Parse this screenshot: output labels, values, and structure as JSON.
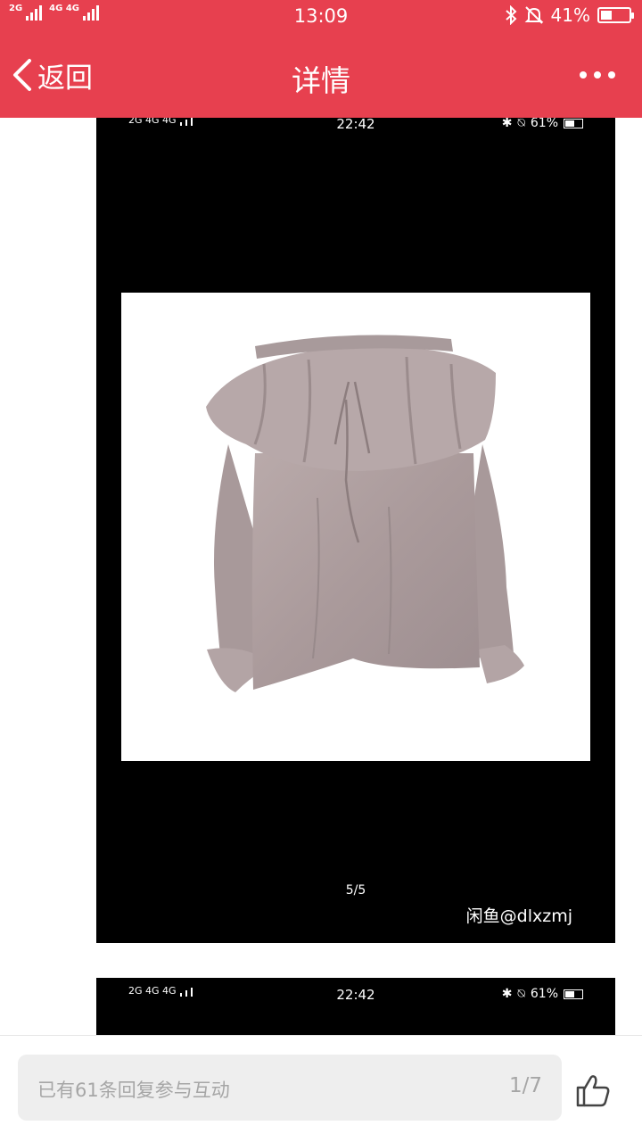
{
  "status_bar": {
    "signal_left_1": "2G",
    "signal_left_2": "4G 4G",
    "time": "13:09",
    "battery_text": "41%",
    "battery_level": 0.41,
    "icons": [
      "bluetooth-icon",
      "bell-muted-icon",
      "battery-icon"
    ]
  },
  "title_bar": {
    "back_label": "返回",
    "title": "详情",
    "more_icon": "more-dots-icon",
    "background": "#e7404f"
  },
  "post_images": [
    {
      "status_signal": "2G 4G 4G",
      "status_time": "22:42",
      "status_battery": "61%",
      "battery_level": 0.61,
      "page_counter": "5/5",
      "watermark": "闲鱼@dlxzmj",
      "product": "lilac off-shoulder ruffle blouse"
    },
    {
      "status_signal": "2G 4G 4G",
      "status_time": "22:42",
      "status_battery": "61%",
      "battery_level": 0.61
    }
  ],
  "bottom_bar": {
    "reply_placeholder": "已有61条回复参与互动",
    "page_indicator": "1/7",
    "like_icon": "thumbs-up-icon"
  }
}
